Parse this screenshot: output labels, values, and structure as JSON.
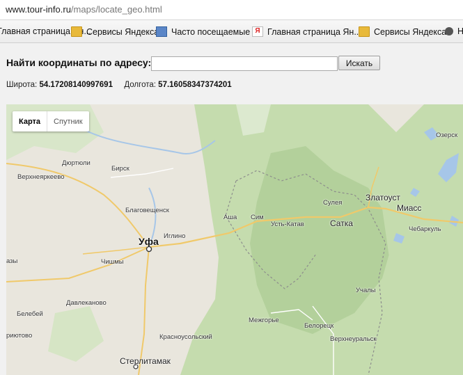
{
  "browser": {
    "url_domain": "www.tour-info.ru",
    "url_path": "/maps/locate_geo.html"
  },
  "bookmarks": [
    {
      "label": "Главная страница Ян...",
      "icon": "yandex-icon"
    },
    {
      "label": "Сервисы Яндекса",
      "icon": "folder-icon"
    },
    {
      "label": "Часто посещаемые",
      "icon": "frequent-sites-icon"
    },
    {
      "label": "Главная страница Ян...",
      "icon": "yandex-icon"
    },
    {
      "label": "Сервисы Яндекса",
      "icon": "folder-icon"
    },
    {
      "label": "Н",
      "icon": "globe-icon"
    }
  ],
  "form": {
    "label": "Найти координаты по адресу:",
    "input_value": "",
    "button_label": "Искать"
  },
  "coords": {
    "lat_label": "Широта:",
    "lat_value": "54.17208140997691",
    "lon_label": "Долгота:",
    "lon_value": "57.16058347374201"
  },
  "map": {
    "type_buttons": [
      "Карта",
      "Спутник"
    ],
    "active_type": "Карта",
    "places": [
      {
        "name": "Дюртюли",
        "size": "small"
      },
      {
        "name": "Верхнеяркеево",
        "size": "small"
      },
      {
        "name": "Бирск",
        "size": "small"
      },
      {
        "name": "Благовещенск",
        "size": "small"
      },
      {
        "name": "Уфа",
        "size": "huge"
      },
      {
        "name": "Иглино",
        "size": "small"
      },
      {
        "name": "Чишмы",
        "size": "small"
      },
      {
        "name": "азы",
        "size": "small"
      },
      {
        "name": "Давлеканово",
        "size": "small"
      },
      {
        "name": "Белебей",
        "size": "small"
      },
      {
        "name": "риютово",
        "size": "small"
      },
      {
        "name": "Красноусольский",
        "size": "small"
      },
      {
        "name": "Стерлитамак",
        "size": "big"
      },
      {
        "name": "Аша",
        "size": "small"
      },
      {
        "name": "Сим",
        "size": "small"
      },
      {
        "name": "Усть-Катав",
        "size": "small"
      },
      {
        "name": "Сулея",
        "size": "small"
      },
      {
        "name": "Сатка",
        "size": "big"
      },
      {
        "name": "Златоуст",
        "size": "big"
      },
      {
        "name": "Миасс",
        "size": "big"
      },
      {
        "name": "Чебаркуль",
        "size": "small"
      },
      {
        "name": "Озерск",
        "size": "small"
      },
      {
        "name": "Учалы",
        "size": "small"
      },
      {
        "name": "Межгорье",
        "size": "small"
      },
      {
        "name": "Белорецк",
        "size": "small"
      },
      {
        "name": "Верхнеуральск",
        "size": "small"
      }
    ]
  }
}
